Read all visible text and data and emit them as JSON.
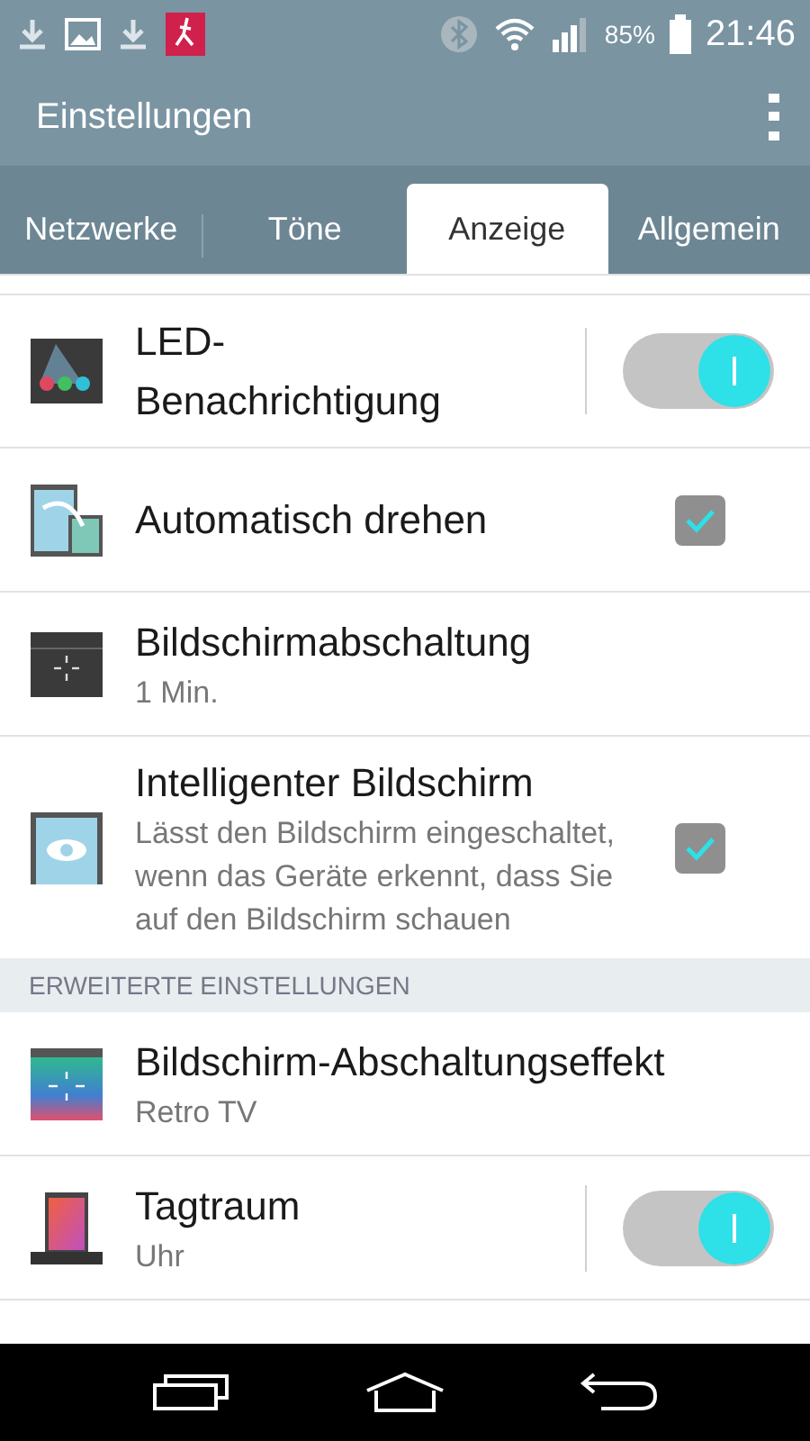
{
  "status_bar": {
    "battery": "85%",
    "time": "21:46"
  },
  "app_bar": {
    "title": "Einstellungen"
  },
  "tabs": [
    {
      "label": "Netzwerke",
      "selected": false
    },
    {
      "label": "Töne",
      "selected": false
    },
    {
      "label": "Anzeige",
      "selected": true
    },
    {
      "label": "Allgemein",
      "selected": false
    }
  ],
  "items": [
    {
      "kind": "toggle",
      "title": "LED-Benachrichtigung",
      "on": true
    },
    {
      "kind": "checkbox",
      "title": "Automatisch drehen",
      "checked": true
    },
    {
      "kind": "plain",
      "title": "Bildschirmabschaltung",
      "subtitle": "1 Min."
    },
    {
      "kind": "checkbox",
      "title": "Intelligenter Bildschirm",
      "subtitle": "Lässt den Bildschirm eingeschaltet, wenn das Geräte erkennt, dass Sie auf den Bildschirm schauen",
      "checked": true
    }
  ],
  "section_header": "ERWEITERTE EINSTELLUNGEN",
  "advanced_items": [
    {
      "kind": "plain",
      "title": "Bildschirm-Abschaltungseffekt",
      "subtitle": "Retro TV"
    },
    {
      "kind": "toggle",
      "title": "Tagtraum",
      "subtitle": "Uhr",
      "on": true
    }
  ]
}
